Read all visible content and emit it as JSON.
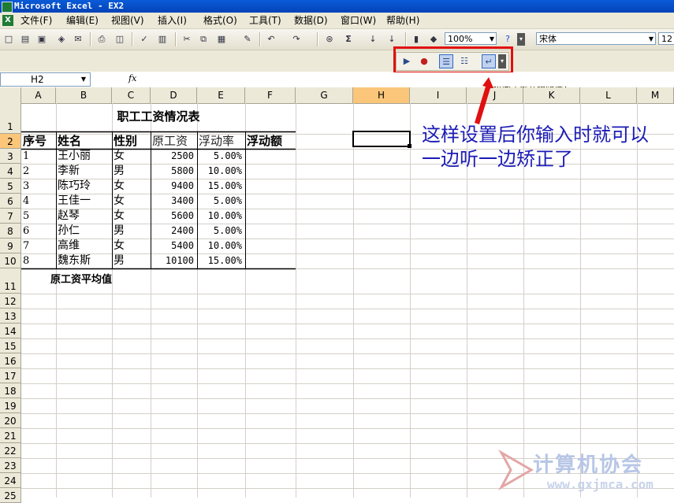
{
  "window": {
    "title": "Microsoft Excel - EX2"
  },
  "menu": [
    "文件(F)",
    "编辑(E)",
    "视图(V)",
    "插入(I)",
    "格式(O)",
    "工具(T)",
    "数据(D)",
    "窗口(W)",
    "帮助(H)"
  ],
  "toolbar": {
    "zoom": "100%",
    "font": "宋体",
    "font_size": "12"
  },
  "speech_toolbar": {
    "tooltip": "按回车键开始朗读"
  },
  "formula_bar": {
    "name_box": "H2",
    "fx": "fx",
    "value": ""
  },
  "columns": [
    "A",
    "B",
    "C",
    "D",
    "E",
    "F",
    "G",
    "H",
    "I",
    "J",
    "K",
    "L",
    "M"
  ],
  "selected_cell": "H2",
  "rows": [
    "1",
    "2",
    "3",
    "4",
    "5",
    "6",
    "7",
    "8",
    "9",
    "10",
    "11",
    "12",
    "13",
    "14",
    "15",
    "16",
    "17",
    "18",
    "19",
    "20",
    "21",
    "22",
    "23",
    "24",
    "25"
  ],
  "sheet": {
    "title": "职工工资情况表",
    "headers": [
      "序号",
      "姓名",
      "性别",
      "原工资",
      "浮动率",
      "浮动额"
    ],
    "records": [
      [
        "1",
        "王小丽",
        "女",
        "2500",
        "5.00%"
      ],
      [
        "2",
        "李新",
        "男",
        "5800",
        "10.00%"
      ],
      [
        "3",
        "陈巧玲",
        "女",
        "9400",
        "15.00%"
      ],
      [
        "4",
        "王佳一",
        "女",
        "3400",
        "5.00%"
      ],
      [
        "5",
        "赵琴",
        "女",
        "5600",
        "10.00%"
      ],
      [
        "6",
        "孙仁",
        "男",
        "2400",
        "5.00%"
      ],
      [
        "7",
        "高维",
        "女",
        "5400",
        "10.00%"
      ],
      [
        "8",
        "魏东斯",
        "男",
        "10100",
        "15.00%"
      ]
    ],
    "avg_label": "原工资平均值"
  },
  "annotation": "这样设置后你输入时就可以一边听一边矫正了",
  "watermark": {
    "text": "计算机协会",
    "url": "www.gxjmca.com"
  },
  "colors": {
    "highlight": "#e01010",
    "annotation": "#1b1bb6",
    "selection": "#fbc67a"
  }
}
